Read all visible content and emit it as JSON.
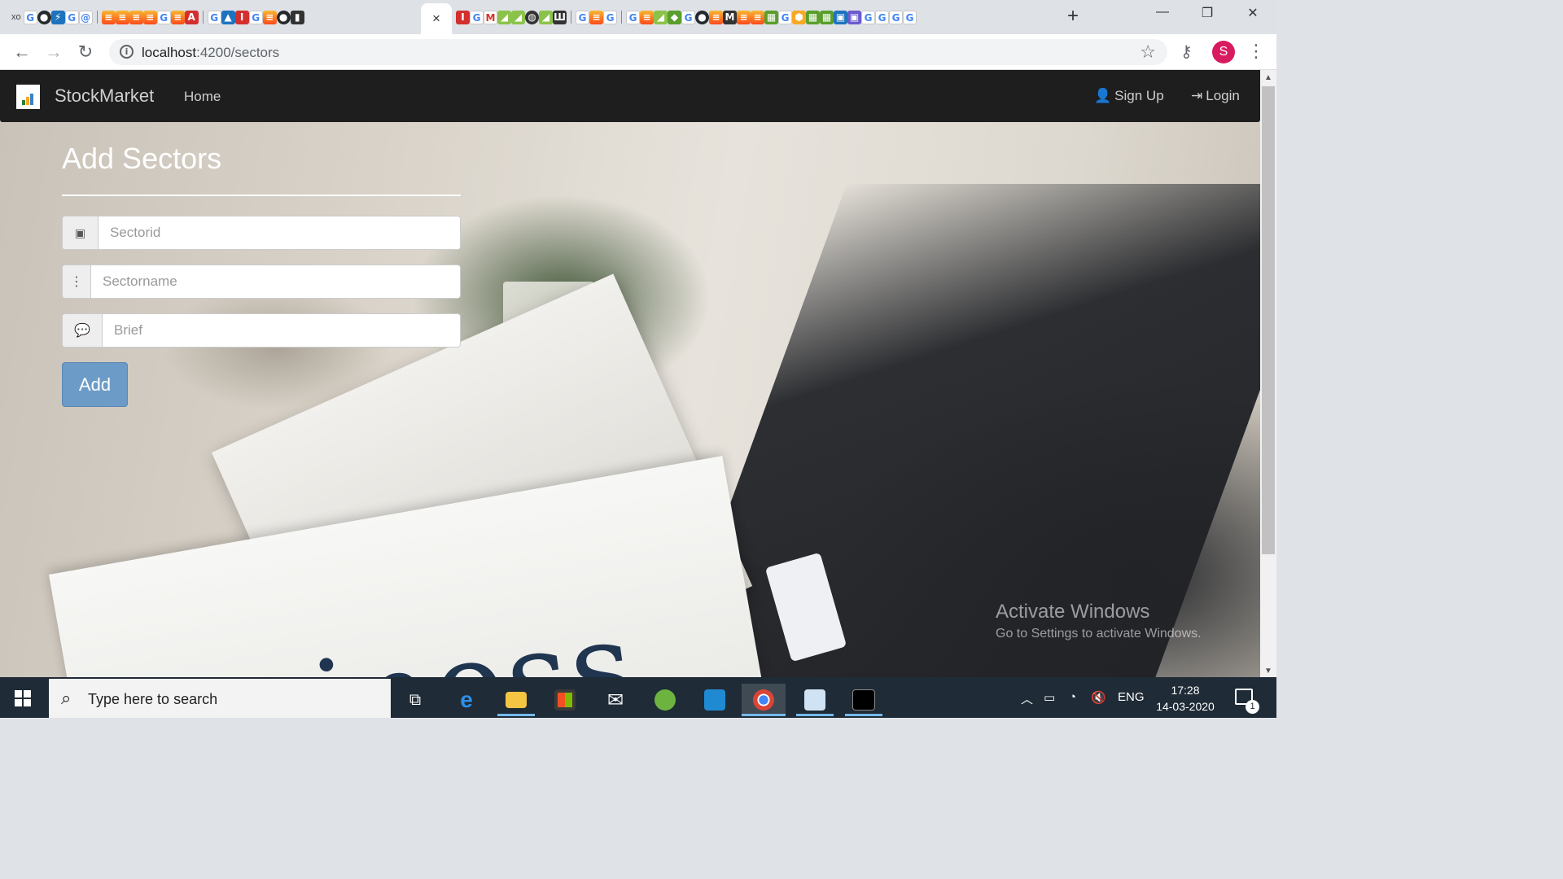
{
  "browser": {
    "url_host": "localhost",
    "url_path": ":4200/sectors",
    "profile_initial": "S",
    "new_tab_glyph": "+",
    "active_tab_close": "×",
    "window_controls": {
      "minimize": "—",
      "restore": "❐",
      "close": "✕"
    },
    "nav": {
      "back": "←",
      "forward": "→",
      "reload": "↻"
    },
    "favicons": [
      "xo",
      "G",
      "github",
      "bolt",
      "G",
      "G",
      "I",
      "fire",
      "fire",
      "fire",
      "G",
      "fire",
      "G",
      "fire",
      "A",
      "I",
      "G",
      "arrow",
      "I",
      "G",
      "fire",
      "github",
      "bars"
    ]
  },
  "navbar": {
    "brand": "StockMarket",
    "home": "Home",
    "signup": "Sign Up",
    "login": "Login"
  },
  "form": {
    "title": "Add Sectors",
    "sectorid_placeholder": "Sectorid",
    "sectorname_placeholder": "Sectorname",
    "brief_placeholder": "Brief",
    "submit_label": "Add"
  },
  "background": {
    "newspaper_word": "Business"
  },
  "watermark": {
    "line1": "Activate Windows",
    "line2": "Go to Settings to activate Windows."
  },
  "taskbar": {
    "search_placeholder": "Type here to search",
    "language": "ENG",
    "time": "17:28",
    "date": "14-03-2020",
    "notification_count": "1"
  }
}
